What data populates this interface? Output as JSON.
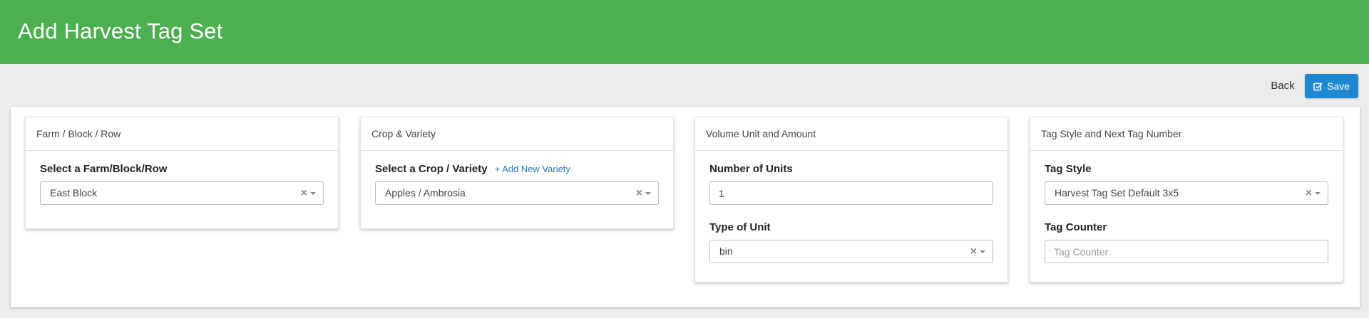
{
  "header": {
    "title": "Add Harvest Tag Set"
  },
  "toolbar": {
    "back_label": "Back",
    "save_label": "Save"
  },
  "cards": {
    "farm": {
      "title": "Farm / Block / Row",
      "label": "Select a Farm/Block/Row",
      "value": "East Block"
    },
    "crop": {
      "title": "Crop & Variety",
      "label": "Select a Crop / Variety",
      "add_link": "+ Add New Variety",
      "value": "Apples / Ambrosia"
    },
    "volume": {
      "title": "Volume Unit and Amount",
      "units_label": "Number of Units",
      "units_value": "1",
      "type_label": "Type of Unit",
      "type_value": "bin"
    },
    "tag": {
      "title": "Tag Style and Next Tag Number",
      "style_label": "Tag Style",
      "style_value": "Harvest Tag Set Default 3x5",
      "counter_label": "Tag Counter",
      "counter_placeholder": "Tag Counter"
    }
  },
  "icons": {
    "clear": "clear-icon",
    "caret": "caret-down-icon",
    "save": "checkbox-edit-icon"
  },
  "colors": {
    "header": "#4caf50",
    "primary": "#1e88d0",
    "link": "#2a7bc0"
  }
}
